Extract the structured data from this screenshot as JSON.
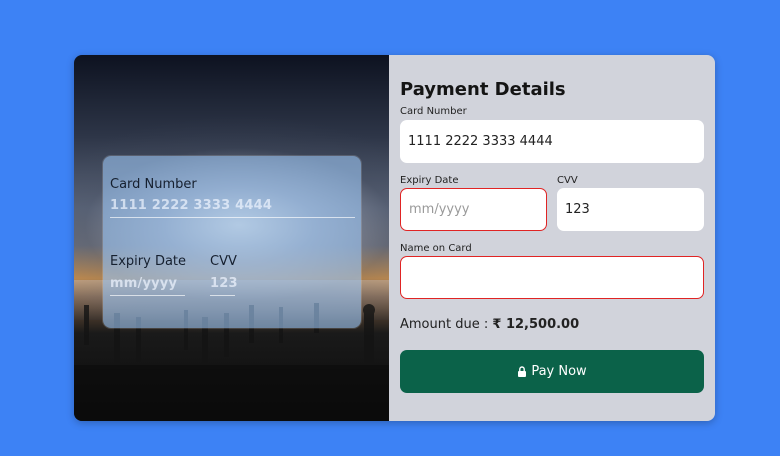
{
  "card_preview": {
    "number_label": "Card Number",
    "number_value": "1111 2222 3333 4444",
    "expiry_label": "Expiry Date",
    "expiry_value": "mm/yyyy",
    "cvv_label": "CVV",
    "cvv_value": "123"
  },
  "form": {
    "title": "Payment Details",
    "card_number_label": "Card Number",
    "card_number_value": "1111 2222 3333 4444",
    "expiry_label": "Expiry Date",
    "expiry_placeholder": "mm/yyyy",
    "cvv_label": "CVV",
    "cvv_value": "123",
    "name_label": "Name on Card",
    "name_value": "",
    "amount_label": "Amount due :",
    "amount_value": "₹ 12,500.00",
    "pay_label": "Pay Now"
  },
  "colors": {
    "background": "#3d82f5",
    "form_bg": "#d1d3db",
    "pay_button": "#0b6249",
    "error_border": "#e02424"
  },
  "icons": [
    "lock-icon"
  ]
}
